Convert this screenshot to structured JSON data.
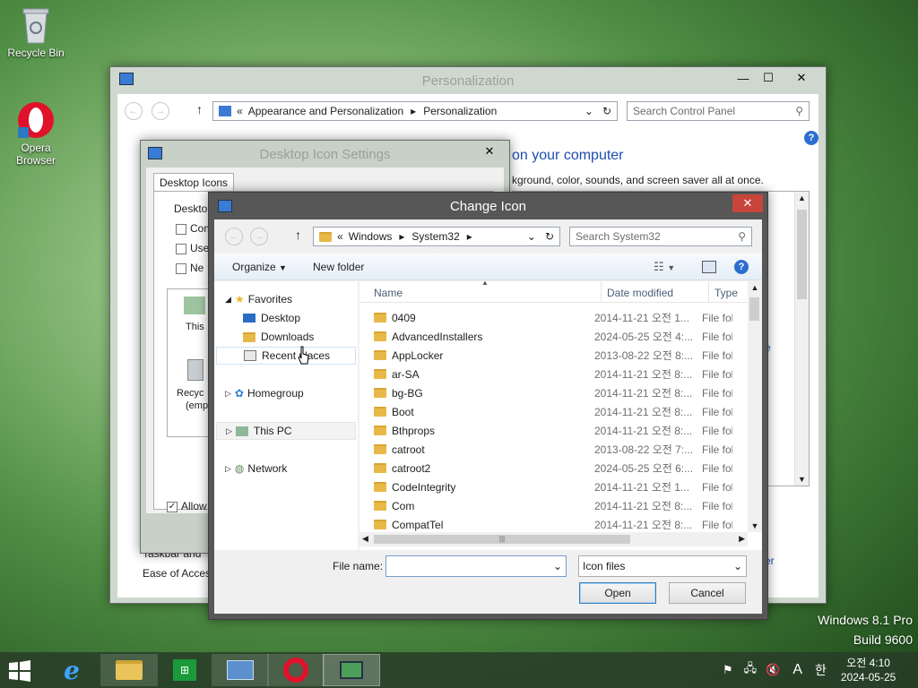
{
  "desktop": {
    "icons": [
      {
        "label": "Recycle Bin"
      },
      {
        "label": "Opera Browser"
      }
    ],
    "watermark": {
      "line1": "Windows 8.1 Pro",
      "line2": "Build 9600"
    }
  },
  "personalization": {
    "title": "Personalization",
    "address": {
      "prefix": "«",
      "crumb1": "Appearance and Personalization",
      "crumb2": "Personalization"
    },
    "search_placeholder": "Search Control Panel",
    "heading": "on your computer",
    "subtext": "kground, color, sounds, and screen saver all at once.",
    "link_partial": "e",
    "link_partial2": "er",
    "ease": "Ease of Access",
    "taskbar_text": "Taskbar and"
  },
  "desktop_icon_settings": {
    "title": "Desktop Icon Settings",
    "tab": "Desktop Icons",
    "group_label": "Desktop",
    "checkboxes": [
      "Com",
      "Use",
      "Ne"
    ],
    "preview1": "This",
    "preview2": "Recyc",
    "preview2b": "(emp",
    "allow": "Allow"
  },
  "change_icon": {
    "title": "Change Icon",
    "address": {
      "prefix": "«",
      "crumb1": "Windows",
      "crumb2": "System32"
    },
    "search_placeholder": "Search System32",
    "toolbar": {
      "organize": "Organize",
      "new_folder": "New folder"
    },
    "nav": {
      "favorites": "Favorites",
      "desktop": "Desktop",
      "downloads": "Downloads",
      "recent": "Recent places",
      "homegroup": "Homegroup",
      "thispc": "This PC",
      "network": "Network"
    },
    "columns": {
      "name": "Name",
      "date": "Date modified",
      "type": "Type"
    },
    "rows": [
      {
        "name": "0409",
        "date": "2014-11-21 오전 1...",
        "type": "File fol"
      },
      {
        "name": "AdvancedInstallers",
        "date": "2024-05-25 오전 4:...",
        "type": "File fol"
      },
      {
        "name": "AppLocker",
        "date": "2013-08-22 오전 8:...",
        "type": "File fol"
      },
      {
        "name": "ar-SA",
        "date": "2014-11-21 오전 8:...",
        "type": "File fol"
      },
      {
        "name": "bg-BG",
        "date": "2014-11-21 오전 8:...",
        "type": "File fol"
      },
      {
        "name": "Boot",
        "date": "2014-11-21 오전 8:...",
        "type": "File fol"
      },
      {
        "name": "Bthprops",
        "date": "2014-11-21 오전 8:...",
        "type": "File fol"
      },
      {
        "name": "catroot",
        "date": "2013-08-22 오전 7:...",
        "type": "File fol"
      },
      {
        "name": "catroot2",
        "date": "2024-05-25 오전 6:...",
        "type": "File fol"
      },
      {
        "name": "CodeIntegrity",
        "date": "2014-11-21 오전 1...",
        "type": "File fol"
      },
      {
        "name": "Com",
        "date": "2014-11-21 오전 8:...",
        "type": "File fol"
      },
      {
        "name": "CompatTel",
        "date": "2014-11-21 오전 8:...",
        "type": "File fol"
      }
    ],
    "filename_label": "File name:",
    "filename_value": "",
    "filetype": "Icon files",
    "open": "Open",
    "cancel": "Cancel"
  },
  "tray": {
    "ime1": "A",
    "ime2": "한",
    "time": "오전 4:10",
    "date": "2024-05-25"
  }
}
